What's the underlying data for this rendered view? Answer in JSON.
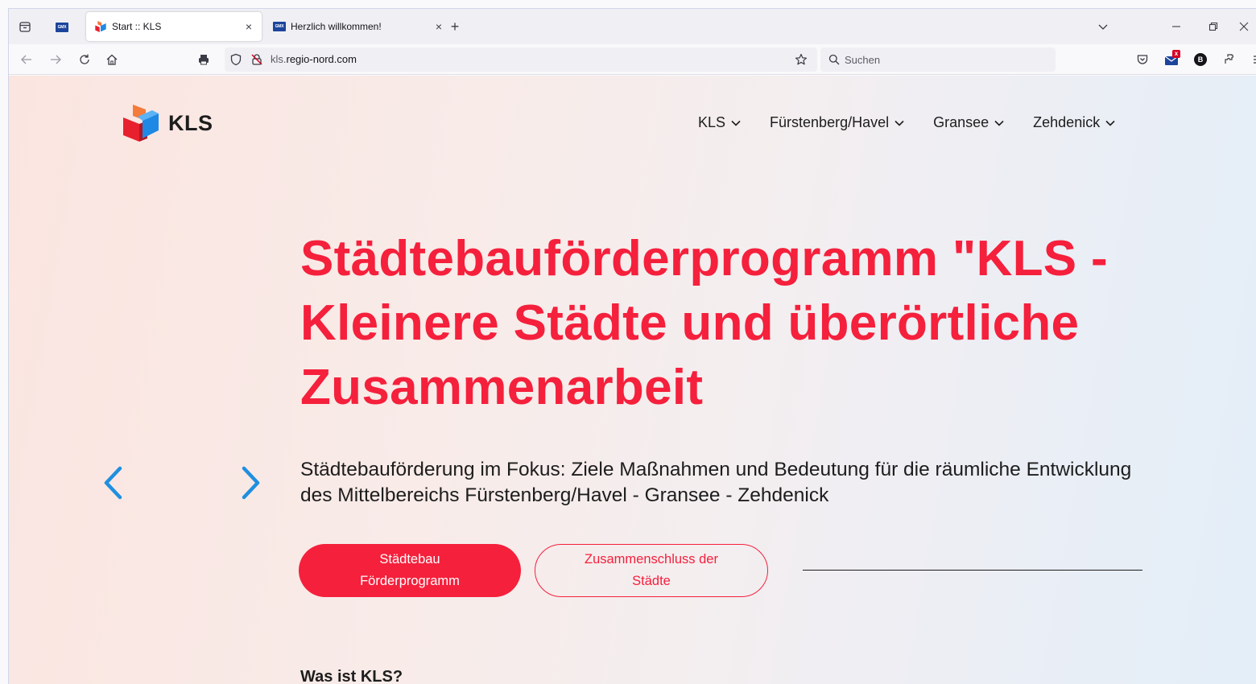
{
  "browser": {
    "tabs": [
      {
        "title": "Start :: KLS",
        "active": true,
        "favicon": "kls-logo-icon"
      },
      {
        "title": "Herzlich willkommen!",
        "active": false,
        "favicon": "gmx-icon"
      }
    ],
    "pinned_tab": {
      "favicon": "gmx-icon",
      "label": "GMX"
    },
    "close_glyph": "×",
    "new_tab_glyph": "+",
    "url": {
      "prefix": "kls.",
      "domain": "regio-nord.com"
    },
    "search": {
      "placeholder": "Suchen"
    },
    "mail_badge": "x",
    "profile_letter": "B",
    "accent_color": "#f5203c"
  },
  "site": {
    "logo_text": "KLS",
    "nav": [
      {
        "label": "KLS"
      },
      {
        "label": "Fürstenberg/Havel"
      },
      {
        "label": "Gransee"
      },
      {
        "label": "Zehdenick"
      }
    ]
  },
  "hero": {
    "title": "Städtebauförderprogramm \"KLS - Kleinere Städte und überörtli­che Zusammenarbeit",
    "subtitle": "Städtebauförderung im Fokus: Ziele Maßnahmen und Bedeutung für die räumliche Entwicklung des Mittelbereichs Fürstenberg/Havel - Gransee - Zehdenick",
    "primary_button": "Städtebau Förderprogramm",
    "secondary_button": "Zusammenschluss der Städte"
  },
  "section": {
    "heading": "Was ist KLS?"
  },
  "colors": {
    "brand_red": "#f5203c",
    "slider_arrow": "#1f8fe0",
    "text_dark": "#1d1d1d"
  }
}
